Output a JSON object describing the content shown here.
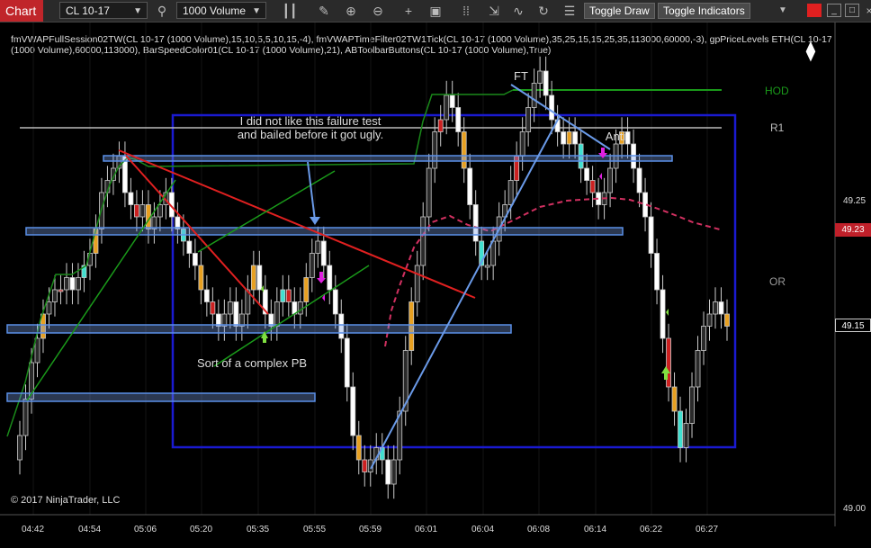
{
  "toolbar": {
    "tab_label": "Chart",
    "instrument": "CL 10-17",
    "bar_type": "1000 Volume",
    "toggle_draw": "Toggle Draw",
    "toggle_indicators": "Toggle Indicators"
  },
  "indicators": {
    "line1": "fmVWAPFullSession02TW(CL 10-17 (1000 Volume),15,10,5,5,10,15,-4), fmVWAPTimeFilter02TW1Tick(CL 10-17 (1000 Volume),35,25,15,15,25,35,113000,60000,-3), gpPriceLevels ETH(CL 10-17",
    "line2": "(1000 Volume),60000,113000), BarSpeedColor01(CL 10-17 (1000 Volume),21), ABToolbarButtons(CL 10-17 (1000 Volume),True)"
  },
  "annotations": {
    "failure_line1": "I did not like this failure test",
    "failure_line2": "and bailed before it got ugly.",
    "complex_pb": "Sort of a complex PB",
    "ft": "FT",
    "anti": "Anti"
  },
  "levels": {
    "hod": "HOD",
    "r1": "R1",
    "or": "OR"
  },
  "price_axis": {
    "ticks": [
      "49.25",
      "49.00"
    ],
    "current_price": "49.23",
    "marker_price": "49.15"
  },
  "time_axis": [
    "04:42",
    "04:54",
    "05:06",
    "05:20",
    "05:35",
    "05:55",
    "05:59",
    "06:01",
    "06:04",
    "06:08",
    "06:14",
    "06:22",
    "06:27"
  ],
  "copyright": "© 2017 NinjaTrader, LLC",
  "colors": {
    "bull": "#2a2a2a",
    "bear": "#ffffff",
    "orange": "#e8a020",
    "red": "#cc2020",
    "cyan": "#40e0d0",
    "zone": "#5a8fe8",
    "vwap": "#d03060",
    "hod": "#1a9a1a"
  },
  "chart_data": {
    "type": "candlestick",
    "ylim": [
      49.0,
      49.4
    ],
    "closes": [
      49.06,
      49.09,
      49.12,
      49.14,
      49.16,
      49.17,
      49.18,
      49.18,
      49.19,
      49.18,
      49.19,
      49.2,
      49.21,
      49.23,
      49.26,
      49.27,
      49.28,
      49.29,
      49.26,
      49.25,
      49.24,
      49.25,
      49.23,
      49.24,
      49.25,
      49.26,
      49.24,
      49.23,
      49.22,
      49.21,
      49.2,
      49.18,
      49.17,
      49.16,
      49.15,
      49.16,
      49.17,
      49.15,
      49.16,
      49.18,
      49.2,
      49.18,
      49.16,
      49.15,
      49.17,
      49.18,
      49.17,
      49.16,
      49.17,
      49.19,
      49.21,
      49.22,
      49.2,
      49.18,
      49.16,
      49.14,
      49.1,
      49.06,
      49.04,
      49.03,
      49.04,
      49.05,
      49.04,
      49.02,
      49.04,
      49.08,
      49.13,
      49.17,
      49.2,
      49.24,
      49.28,
      49.31,
      49.32,
      49.34,
      49.33,
      49.31,
      49.28,
      49.25,
      49.22,
      49.2,
      49.2,
      49.22,
      49.24,
      49.25,
      49.27,
      49.29,
      49.31,
      49.33,
      49.35,
      49.36,
      49.34,
      49.32,
      49.31,
      49.3,
      49.31,
      49.3,
      49.28,
      49.27,
      49.26,
      49.25,
      49.26,
      49.28,
      49.3,
      49.31,
      49.3,
      49.28,
      49.26,
      49.24,
      49.21,
      49.18,
      49.14,
      49.1,
      49.08,
      49.05,
      49.07,
      49.1,
      49.13,
      49.15,
      49.16,
      49.17,
      49.16,
      49.15
    ]
  }
}
